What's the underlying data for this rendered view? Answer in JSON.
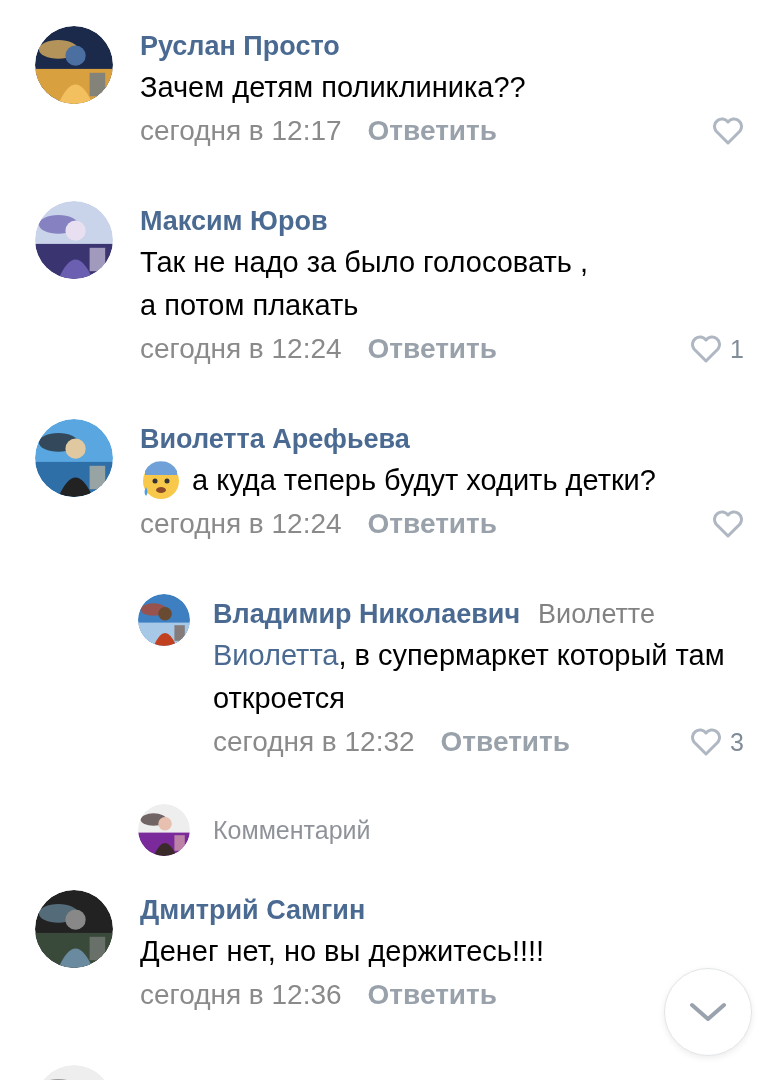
{
  "comments": [
    {
      "kind": "comment",
      "author": "Руслан Просто",
      "text": "Зачем детям поликлиника??",
      "time": "сегодня в 12:17",
      "reply": "Ответить",
      "like_button": true
    },
    {
      "kind": "comment",
      "author": "Максим Юров",
      "text": "Так не надо за было голосовать , а потом плакать",
      "time": "сегодня в 12:24",
      "reply": "Ответить",
      "like_button": true,
      "likes": "1"
    },
    {
      "kind": "comment",
      "author": "Виолетта Арефьева",
      "emoji": true,
      "text": "а куда теперь будут ходить детки?",
      "time": "сегодня в 12:24",
      "reply": "Ответить",
      "like_button": true
    },
    {
      "kind": "reply",
      "author": "Владимир Николаевич",
      "reply_to": "Виолетте",
      "mention": "Виолетта",
      "text": ", в супермаркет который там откроется",
      "time": "сегодня в 12:32",
      "reply": "Ответить",
      "like_button": true,
      "likes": "3"
    },
    {
      "kind": "input",
      "placeholder": "Комментарий"
    },
    {
      "kind": "comment",
      "author": "Дмитрий Самгин",
      "text": "Денег нет, но вы держитесь!!!!",
      "time": "сегодня в 12:36",
      "reply": "Ответить",
      "like_button": false
    },
    {
      "kind": "comment"
    }
  ]
}
